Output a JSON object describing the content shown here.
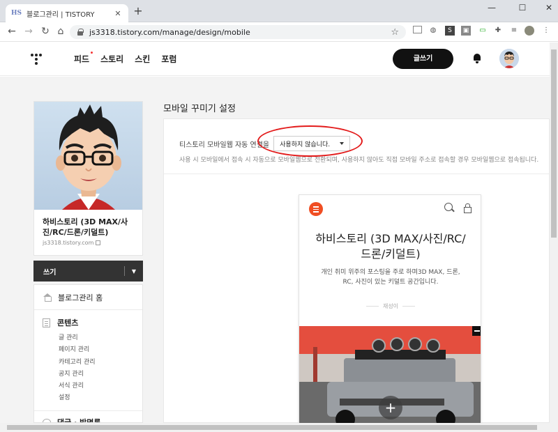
{
  "browser": {
    "tab_favicon": "HS",
    "tab_title": "블로그관리 | TISTORY",
    "tab_close": "✕",
    "new_tab": "+",
    "url": "js3318.tistory.com/manage/design/mobile",
    "minimize": "—",
    "maximize": "☐",
    "close": "✕"
  },
  "header": {
    "nav": [
      "피드",
      "스토리",
      "스킨",
      "포럼"
    ],
    "write_label": "글쓰기"
  },
  "sidebar": {
    "blog_name": "하비스토리 (3D MAX/사진/RC/드론/키덜트)",
    "blog_url": "js3318.tistory.com",
    "write_bar_label": "쓰기",
    "home_label": "블로그관리 홈",
    "content_label": "콘텐츠",
    "content_items": [
      "글 관리",
      "페이지 관리",
      "카테고리 관리",
      "공지 관리",
      "서식 관리",
      "설정"
    ],
    "comment_label": "댓글 · 방명록"
  },
  "main": {
    "title": "모바일 꾸미기 설정",
    "setting_label": "티스토리 모바일웹 자동 연결을",
    "select_value": "사용하지 않습니다.",
    "description": "사용 시 모바일에서 접속 시 자동으로 모바일웹으로 전환되며, 사용하지 않아도 직접 모바일 주소로 접속할 경우 모바일웹으로 접속됩니다."
  },
  "preview": {
    "blog_title": "하비스토리 (3D MAX/사진/RC/드론/키덜트)",
    "blog_desc": "개인 취미 위주의 포스팅을 주로 하며3D MAX, 드론, RC, 사진이 있는 키덜트 공간입니다.",
    "author": "재성이",
    "add_button": "+"
  },
  "colors": {
    "accent_orange": "#f04e23",
    "annotation_red": "#e31b1b",
    "header_button": "#111111"
  }
}
